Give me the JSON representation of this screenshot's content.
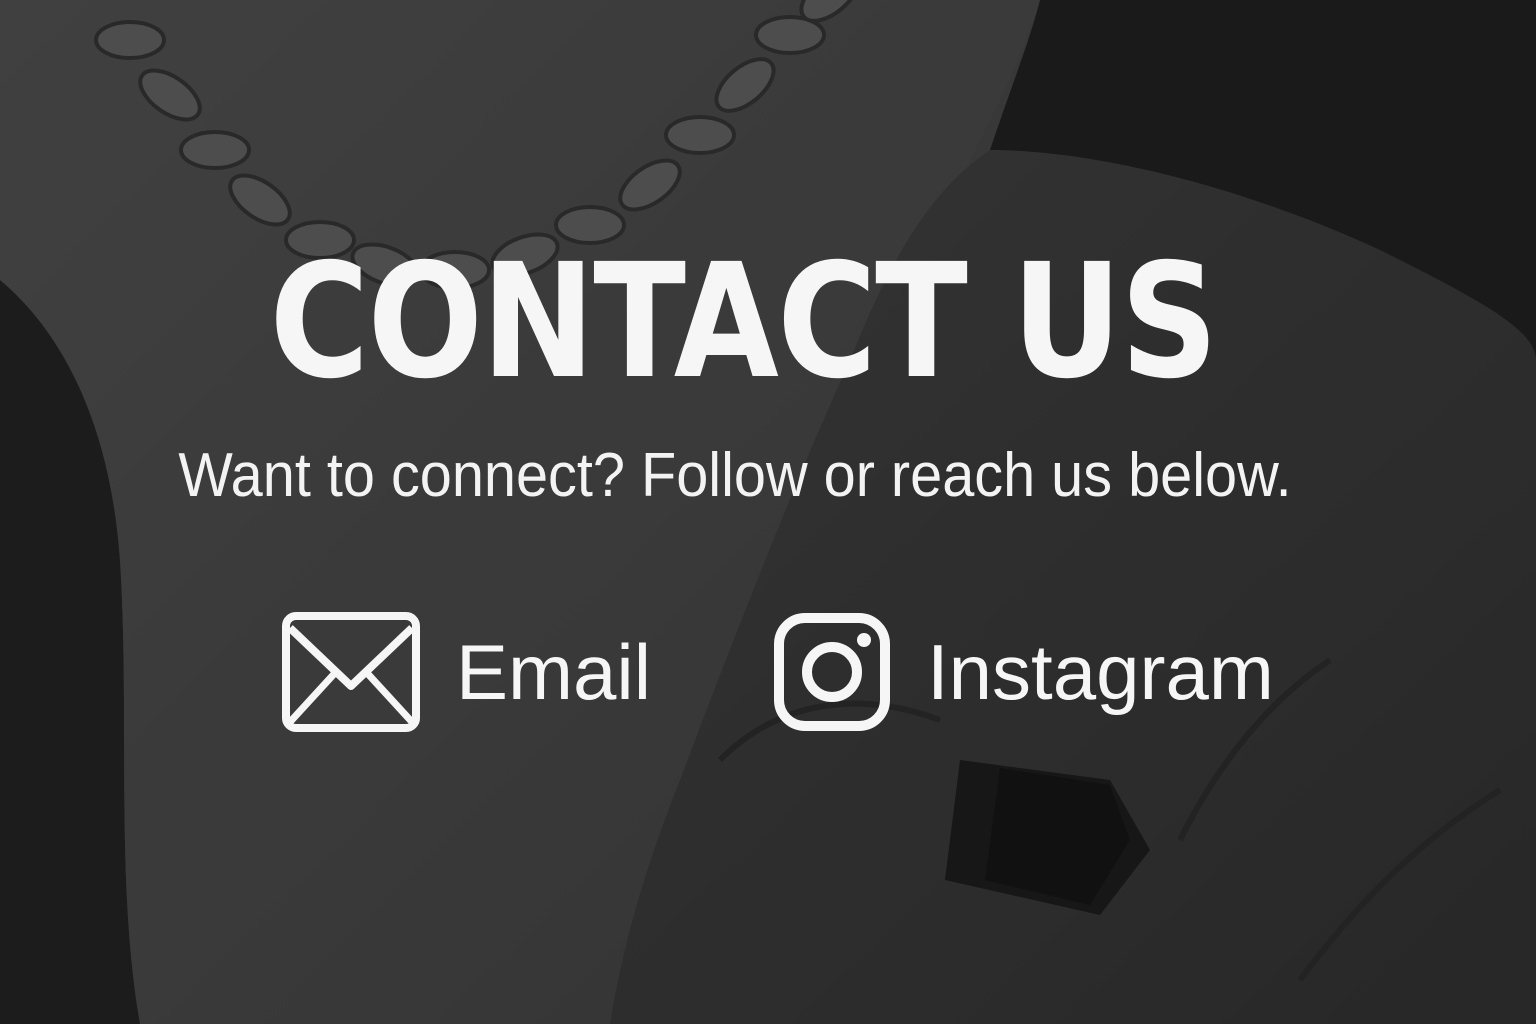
{
  "heading": "CONTACT US",
  "subheading": "Want to connect? Follow or reach us below.",
  "links": {
    "email": {
      "label": "Email",
      "icon": "envelope-icon"
    },
    "instagram": {
      "label": "Instagram",
      "icon": "instagram-icon"
    }
  },
  "colors": {
    "text": "#f6f6f6",
    "background": "#3a3a3a"
  }
}
